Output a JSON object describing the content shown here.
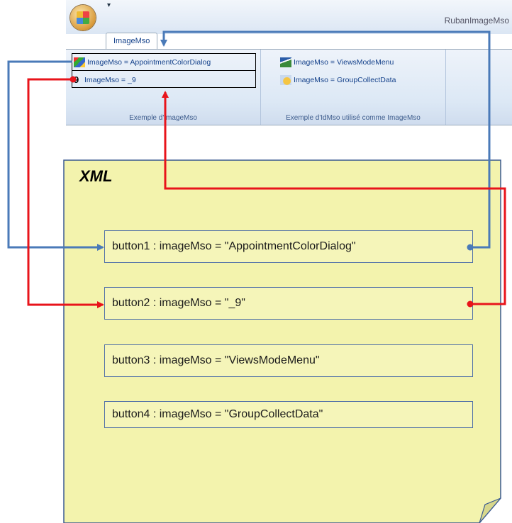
{
  "ribbon": {
    "app_title": "RubanImageMso",
    "qat_symbol": "▾",
    "tab_label": "ImageMso",
    "group1": {
      "label": "Exemple d'ImageMso",
      "btn1": "ImageMso = AppointmentColorDialog",
      "btn2_glyph": "9",
      "btn2": "ImageMso = _9"
    },
    "group2": {
      "label": "Exemple d'IdMso utilisé comme ImageMso",
      "btn1": "ImageMso = ViewsModeMenu",
      "btn2": "ImageMso = GroupCollectData"
    }
  },
  "xml": {
    "title": "XML",
    "buttons": [
      {
        "text": "button1 : imageMso = \"AppointmentColorDialog\""
      },
      {
        "text": "button2 : imageMso = \"_9\""
      },
      {
        "text": "button3 : imageMso = \"ViewsModeMenu\""
      },
      {
        "text": "button4 : imageMso = \"GroupCollectData\""
      }
    ]
  },
  "colors": {
    "note_fill": "#f3f3ad",
    "note_border": "#3a5a92",
    "blue_arrow": "#4a7ab8",
    "red_arrow": "#e8141b"
  }
}
